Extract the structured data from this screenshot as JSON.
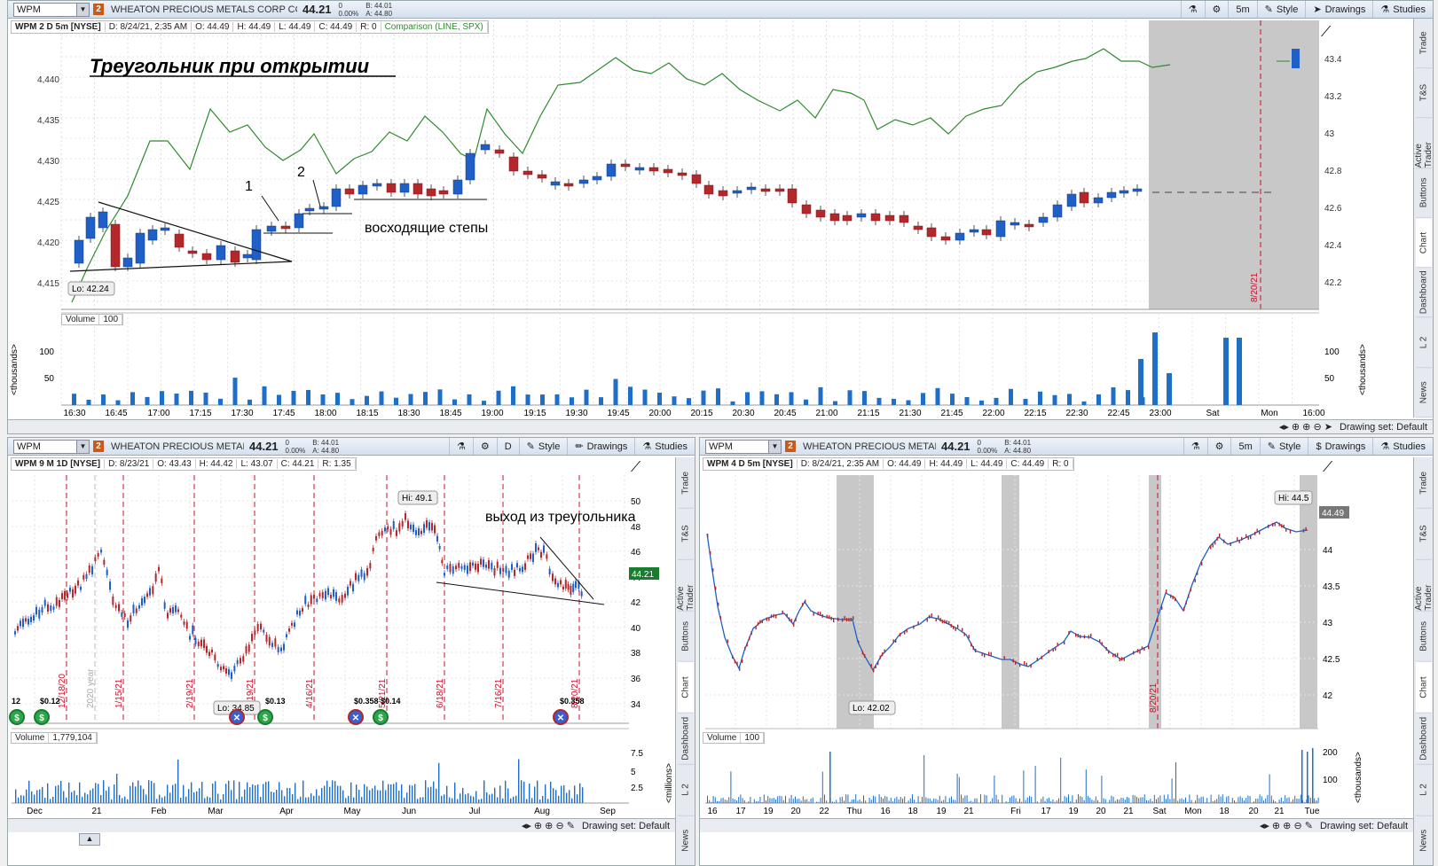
{
  "main": {
    "symbol": "WPM",
    "link": "2",
    "company": "WHEATON PRECIOUS METALS CORP COM",
    "last": "44.21",
    "change": "0",
    "change_pct": "0.00%",
    "bid": "B: 44.01",
    "ask": "A: 44.80",
    "toolbar": {
      "interval": "5m",
      "style": "Style",
      "drawings": "Drawings",
      "studies": "Studies"
    },
    "info": {
      "title": "WPM 2 D 5m [NYSE]",
      "date": "D: 8/24/21, 2:35 AM",
      "open": "O: 44.49",
      "high": "H: 44.49",
      "low": "L: 44.49",
      "close": "C: 44.49",
      "range": "R: 0",
      "comparison": "Comparison (LINE, SPX)"
    },
    "annotation_title": "Треугольник при открытии",
    "annotation_steps": "восходящие степы",
    "mark1": "1",
    "mark2": "2",
    "lo_label": "Lo: 42.24",
    "left_axis": [
      "4,440",
      "4,435",
      "4,430",
      "4,425",
      "4,420",
      "4,415"
    ],
    "right_axis": [
      "43.4",
      "43.2",
      "43",
      "42.8",
      "42.6",
      "42.4",
      "42.2"
    ],
    "date_marker": "8/20/21",
    "volume_label": "Volume",
    "volume_value": "100",
    "vol_axis": [
      "100",
      "50"
    ],
    "vol_axis_unit": "<thousands>",
    "time_axis": [
      "16:30",
      "16:45",
      "17:00",
      "17:15",
      "17:30",
      "17:45",
      "18:00",
      "18:15",
      "18:30",
      "18:45",
      "19:00",
      "19:15",
      "19:30",
      "19:45",
      "20:00",
      "20:15",
      "20:30",
      "20:45",
      "21:00",
      "21:15",
      "21:30",
      "21:45",
      "22:00",
      "22:15",
      "22:30",
      "22:45",
      "23:00",
      "Sat",
      "Mon",
      "16:00"
    ],
    "drawing_set": "Drawing set: Default",
    "side_tabs": [
      "Trade",
      "T&S",
      "Active Trader",
      "Buttons",
      "Chart",
      "Dashboard",
      "L 2",
      "News"
    ]
  },
  "bl": {
    "symbol": "WPM",
    "link": "2",
    "company": "WHEATON PRECIOUS METAL...",
    "last": "44.21",
    "change": "0",
    "change_pct": "0.00%",
    "bid": "B: 44.01",
    "ask": "A: 44.80",
    "toolbar": {
      "interval": "D",
      "style": "Style",
      "drawings": "Drawings",
      "studies": "Studies"
    },
    "info": {
      "title": "WPM 9 M 1D [NYSE]",
      "date": "D: 8/23/21",
      "open": "O: 43.43",
      "high": "H: 44.42",
      "low": "L: 43.07",
      "close": "C: 44.21",
      "range": "R: 1.35"
    },
    "annotation": "выход из треугольника",
    "hi_label": "Hi: 49.1",
    "lo_label": "Lo: 34.85",
    "price_tag": "44.21",
    "right_axis": [
      "50",
      "48",
      "46",
      "44",
      "42",
      "40",
      "38",
      "36",
      "34"
    ],
    "date_markers": [
      "12/18/20",
      "2020 year",
      "1/15/21",
      "2/19/21",
      "3/19/21",
      "4/16/21",
      "5/21/21",
      "6/18/21",
      "7/16/21",
      "8/20/21"
    ],
    "dividends": [
      "12",
      "$0.12",
      "$0.13",
      "$0.358",
      "$0.14",
      "$0.358"
    ],
    "volume_label": "Volume",
    "volume_value": "1,779,104",
    "vol_axis": [
      "7.5",
      "5",
      "2.5"
    ],
    "vol_axis_unit": "<millions>",
    "time_axis": [
      "Dec",
      "21",
      "Feb",
      "Mar",
      "Apr",
      "May",
      "Jun",
      "Jul",
      "Aug",
      "Sep"
    ],
    "drawing_set": "Drawing set: Default",
    "side_tabs": [
      "Trade",
      "T&S",
      "Active Trader",
      "Buttons",
      "Chart",
      "Dashboard",
      "L 2",
      "News"
    ]
  },
  "br": {
    "symbol": "WPM",
    "link": "2",
    "company": "WHEATON PRECIOUS METAL...",
    "last": "44.21",
    "change": "0",
    "change_pct": "0.00%",
    "bid": "B: 44.01",
    "ask": "A: 44.80",
    "toolbar": {
      "interval": "5m",
      "style": "Style",
      "drawings": "Drawings",
      "studies": "Studies"
    },
    "info": {
      "title": "WPM 4 D 5m [NYSE]",
      "date": "D: 8/24/21, 2:35 AM",
      "open": "O: 44.49",
      "high": "H: 44.49",
      "low": "L: 44.49",
      "close": "C: 44.49",
      "range": "R: 0"
    },
    "hi_label": "Hi: 44.5",
    "lo_label": "Lo: 42.02",
    "price_tag": "44.49",
    "right_axis": [
      "44",
      "43.5",
      "43",
      "42.5",
      "42"
    ],
    "date_marker": "8/20/21",
    "volume_label": "Volume",
    "volume_value": "100",
    "vol_axis": [
      "200",
      "100"
    ],
    "vol_axis_unit": "<thousands>",
    "time_axis": [
      "16",
      "17",
      "19",
      "20",
      "22",
      "Thu",
      "16",
      "18",
      "19",
      "21",
      "Fri",
      "17",
      "19",
      "20",
      "21",
      "Sat",
      "Mon",
      "18",
      "20",
      "21",
      "Tue"
    ],
    "drawing_set": "Drawing set: Default",
    "side_tabs": [
      "Trade",
      "T&S",
      "Active Trader",
      "Buttons",
      "Chart",
      "Dashboard",
      "L 2",
      "News"
    ]
  },
  "colors": {
    "up": "#1f5fc8",
    "down": "#b4272b",
    "compare": "#2f8a2f",
    "dash": "#c8102e",
    "vol": "#1f6fc8"
  }
}
